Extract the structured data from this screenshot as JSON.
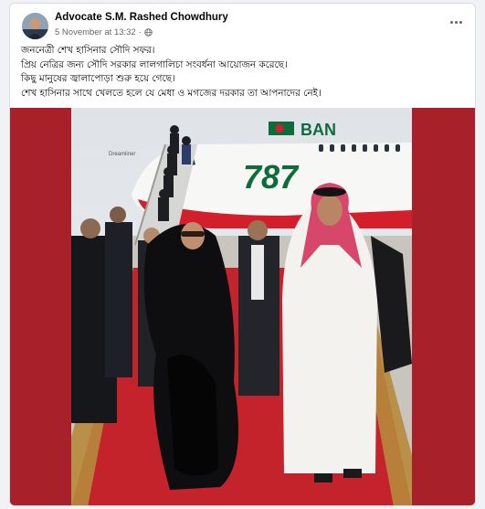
{
  "post": {
    "author": "Advocate S.M. Rashed Chowdhury",
    "timestamp": "5 November at 13:32",
    "separator": "·",
    "privacy_icon": "globe-icon",
    "more_icon": "more-options-icon",
    "text_lines": [
      "জননেত্রী শেখ হাসিনার সৌদি সফর।",
      "প্রিয় নেত্রির জন্য সৌদি সরকার লালগালিচা সংবর্ধনা আয়োজন করেছে।",
      "কিছু মানুষের জ্বালাপোড়া শুরু হয়ে গেছে।",
      "শেখ হাসিনার সাথে খেলতে হলে যে মেধা ও মগজের দরকার তা আপনাদের নেই।"
    ]
  },
  "photo": {
    "aircraft_brand_text": "BAN",
    "aircraft_model_text": "787",
    "aircraft_registration_text": "Dreamliner",
    "colors": {
      "frame_red": "#a8212a",
      "carpet_red": "#c4232b",
      "carpet_border": "#b68a3c",
      "livery_green": "#0f6b3b",
      "livery_red": "#d21f2b"
    }
  }
}
